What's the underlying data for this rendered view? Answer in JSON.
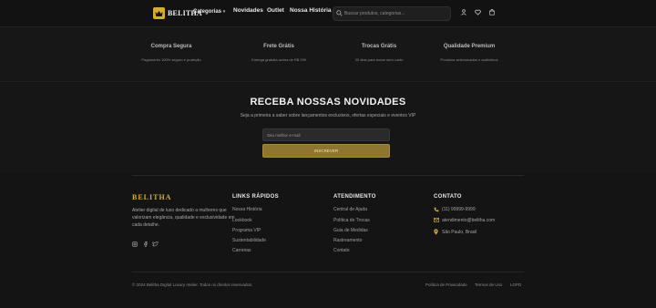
{
  "header": {
    "logo_text": "BELITHA",
    "nav": [
      "Categorias",
      "Novidades",
      "Outlet",
      "Nossa História"
    ],
    "search_placeholder": "Buscar produtos, categorias..."
  },
  "features": [
    {
      "title": "Compra Segura",
      "desc": "Pagamento 100% seguro e proteção"
    },
    {
      "title": "Frete Grátis",
      "desc": "Entrega gratuita acima de R$ 299"
    },
    {
      "title": "Trocas Grátis",
      "desc": "30 dias para trocar sem custo"
    },
    {
      "title": "Qualidade Premium",
      "desc": "Produtos selecionados e autênticos"
    }
  ],
  "newsletter": {
    "title": "RECEBA NOSSAS NOVIDADES",
    "subtitle": "Seja a primeira a saber sobre lançamentos exclusivos, ofertas especiais e eventos VIP",
    "email_placeholder": "Seu melhor e-mail",
    "button": "INSCREVER"
  },
  "footer": {
    "brand": "BELITHA",
    "brand_desc": "Atelier digital de luxo dedicado a mulheres que valorizam elegância, qualidade e exclusividade em cada detalhe.",
    "columns": [
      {
        "title": "LINKS RÁPIDOS",
        "links": [
          "Nossa História",
          "Lookbook",
          "Programa VIP",
          "Sustentabilidade",
          "Carreiras"
        ]
      },
      {
        "title": "ATENDIMENTO",
        "links": [
          "Central de Ajuda",
          "Política de Trocas",
          "Guia de Medidas",
          "Rastreamento",
          "Contato"
        ]
      }
    ],
    "contact": {
      "title": "CONTATO",
      "phone": "(11) 99999-9999",
      "email": "atendimento@belitha.com",
      "location": "São Paulo, Brasil"
    },
    "copyright": "© 2024 Belitha Digital Luxury Atelier. Todos os direitos reservados.",
    "legal": [
      "Política de Privacidade",
      "Termos de Uso",
      "LGPD"
    ]
  },
  "colors": {
    "accent": "#d4ad37",
    "button": "#8e7530",
    "background": "#141414"
  }
}
